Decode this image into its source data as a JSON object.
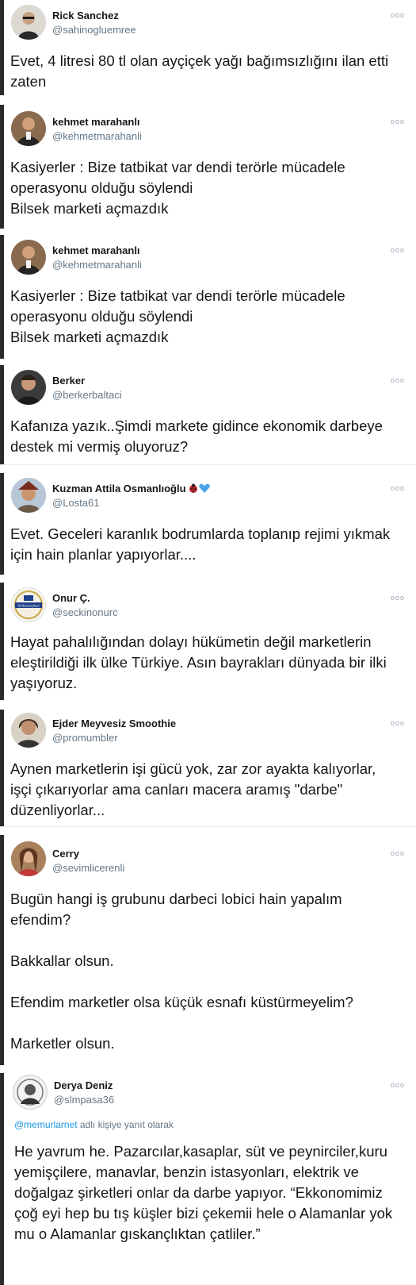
{
  "tweets": [
    {
      "author": "Rick Sanchez",
      "handle": "@sahinogluemree",
      "more": "ooo",
      "text": "Evet, 4 litresi 80 tl olan ayçiçek yağı bağımsızlığını ilan etti\nzaten"
    },
    {
      "author": "kehmet marahanlı",
      "handle": "@kehmetmarahanli",
      "more": "ooo",
      "text": "Kasiyerler : Bize tatbikat var dendi terörle mücadele\noperasyonu olduğu söylendi\nBilsek marketi açmazdık"
    },
    {
      "author": "kehmet marahanlı",
      "handle": "@kehmetmarahanli",
      "more": "ooo",
      "text": "Kasiyerler : Bize tatbikat var dendi terörle mücadele\noperasyonu olduğu söylendi\nBilsek marketi açmazdık"
    },
    {
      "author": "Berker",
      "handle": "@berkerbaltaci",
      "more": "ooo",
      "text": "Kafanıza yazık..Şimdi markete gidince ekonomik darbeye\ndestek mi vermiş oluyoruz?"
    },
    {
      "author": "Kuzman Attila Osmanlıoğlu",
      "handle": "@Losta61",
      "more": "ooo",
      "text": "Evet. Geceleri karanlık bodrumlarda toplanıp rejimi yıkmak\niçin hain planlar yapıyorlar...."
    },
    {
      "author": "Onur Ç.",
      "handle": "@seckinonurc",
      "more": "ooo",
      "avatar_label": "Weihenstephan",
      "text": "Hayat pahalılığından dolayı hükümetin değil marketlerin\neleştirildiği ilk ülke Türkiye. Asın bayrakları dünyada bir ilki\nyaşıyoruz."
    },
    {
      "author": "Ejder Meyvesiz Smoothie",
      "handle": "@promumbler",
      "more": "ooo",
      "text": "Aynen marketlerin işi gücü yok, zar zor ayakta kalıyorlar,\nişçi çıkarıyorlar ama canları macera aramış \"darbe\"\ndüzenliyorlar..."
    },
    {
      "author": "Cerry",
      "handle": "@sevimlicerenli",
      "more": "ooo",
      "text": "Bugün hangi iş grubunu darbeci lobici hain yapalım\nefendim?\n\nBakkallar olsun.\n\nEfendim marketler olsa küçük esnafı küstürmeyelim?\n\nMarketler olsun."
    },
    {
      "author": "Derya Deniz",
      "handle": "@slmpasa36",
      "more": "ooo",
      "reply_mention": "@memurlarnet",
      "reply_suffix": " adlı kişiye yanıt olarak",
      "text": "He yavrum he. Pazarcılar,kasaplar, süt ve peynirciler,kuru\nyemişçilere, manavlar, benzin istasyonları, elektrik ve\ndoğalgaz şirketleri onlar da darbe yapıyor. “Ekkonomimiz\nçoğ eyi hep bu tış küşler bizi çekemii hele o Alamanlar yok\nmu o Alamanlar gıskançlıktan çatliler.”"
    }
  ]
}
